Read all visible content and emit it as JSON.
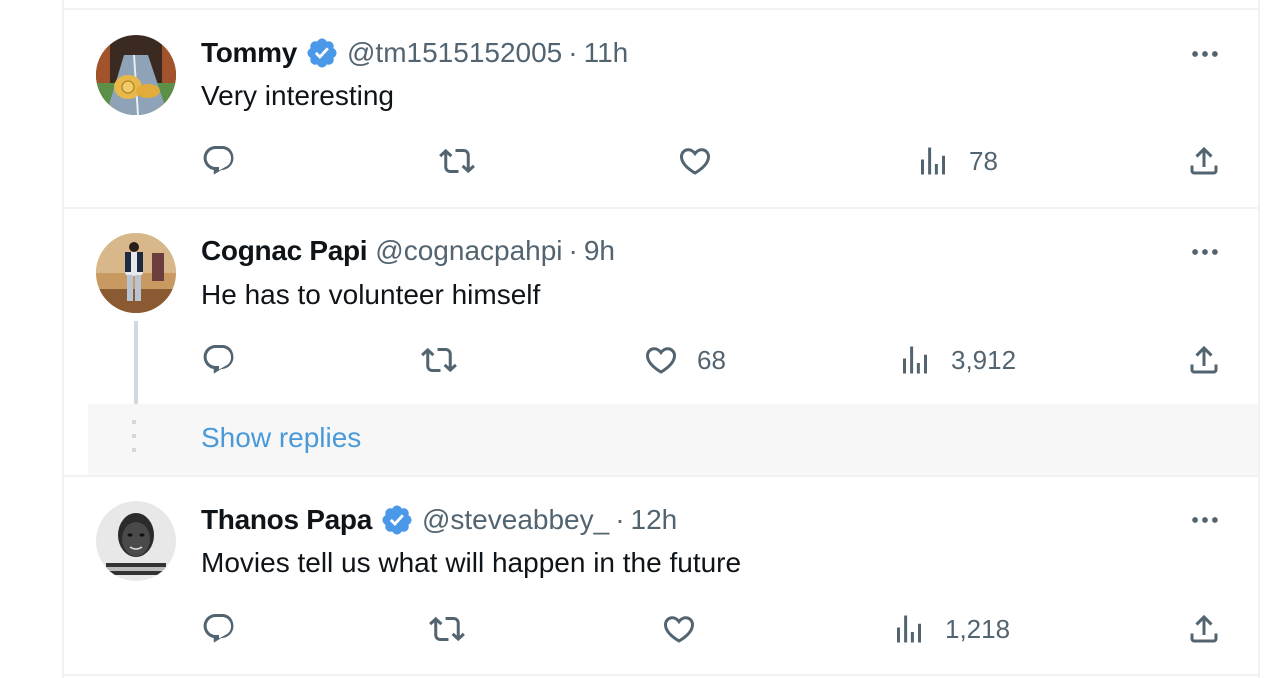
{
  "colors": {
    "accent": "#1d9bf0",
    "link": "#4a99d8",
    "text_primary": "#0f1419",
    "text_secondary": "#536471",
    "divider": "#eff3f4"
  },
  "tweets": [
    {
      "name": "Tommy",
      "verified": true,
      "handle": "@tm1515152005",
      "separator": "·",
      "time": "11h",
      "text": "Very interesting",
      "avatar_icon": "avatar-cartoon-cat",
      "actions": {
        "reply_count": "",
        "retweet_count": "",
        "like_count": "",
        "views_count": "78"
      }
    },
    {
      "name": "Cognac Papi",
      "verified": false,
      "handle": "@cognacpahpi",
      "separator": "·",
      "time": "9h",
      "text": "He has to volunteer himself",
      "avatar_icon": "avatar-person-standing",
      "actions": {
        "reply_count": "",
        "retweet_count": "",
        "like_count": "68",
        "views_count": "3,912"
      },
      "show_replies_label": "Show replies"
    },
    {
      "name": "Thanos Papa",
      "verified": true,
      "handle": "@steveabbey_",
      "separator": "·",
      "time": "12h",
      "text": "Movies tell us what will happen in the future",
      "avatar_icon": "avatar-child-portrait",
      "actions": {
        "reply_count": "",
        "retweet_count": "",
        "like_count": "",
        "views_count": "1,218"
      }
    }
  ],
  "icons": {
    "reply": "reply-icon",
    "retweet": "retweet-icon",
    "like": "heart-icon",
    "views": "views-icon",
    "share": "share-icon",
    "more": "more-icon",
    "verified": "verified-badge-icon"
  }
}
